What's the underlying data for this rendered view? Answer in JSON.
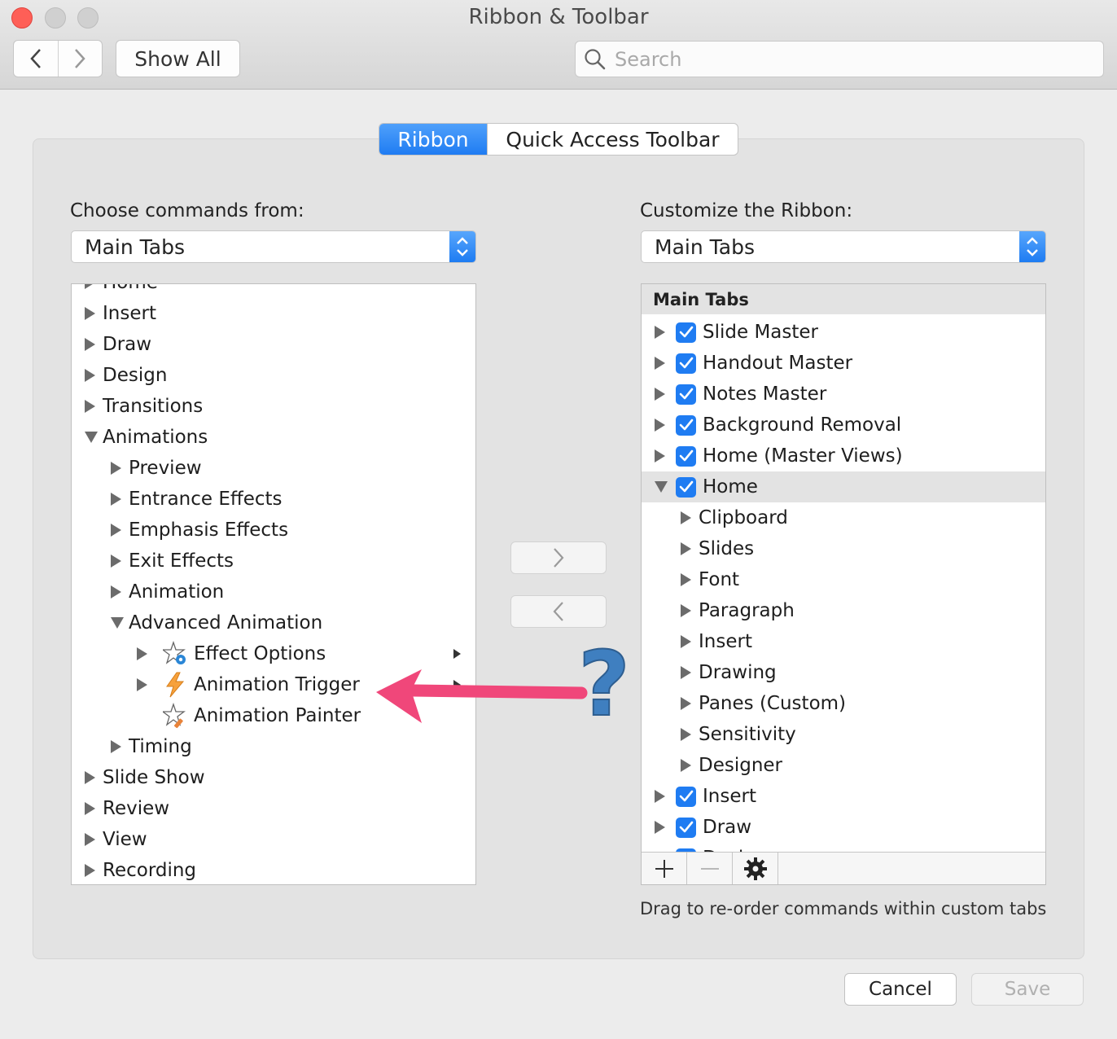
{
  "window": {
    "title": "Ribbon & Toolbar"
  },
  "toolbar": {
    "back_icon": "chevron-left-icon",
    "forward_icon": "chevron-right-icon",
    "show_all_label": "Show All",
    "search_placeholder": "Search",
    "search_value": ""
  },
  "tabs": {
    "items": [
      {
        "label": "Ribbon",
        "selected": true
      },
      {
        "label": "Quick Access Toolbar",
        "selected": false
      }
    ]
  },
  "left": {
    "label": "Choose commands from:",
    "popup_value": "Main Tabs",
    "rows": [
      {
        "label": "Home",
        "kind": "collapsed",
        "level": 0
      },
      {
        "label": "Insert",
        "kind": "collapsed",
        "level": 0
      },
      {
        "label": "Draw",
        "kind": "collapsed",
        "level": 0
      },
      {
        "label": "Design",
        "kind": "collapsed",
        "level": 0
      },
      {
        "label": "Transitions",
        "kind": "collapsed",
        "level": 0
      },
      {
        "label": "Animations",
        "kind": "expanded",
        "level": 0
      },
      {
        "label": "Preview",
        "kind": "collapsed",
        "level": 1
      },
      {
        "label": "Entrance Effects",
        "kind": "collapsed",
        "level": 1
      },
      {
        "label": "Emphasis Effects",
        "kind": "collapsed",
        "level": 1
      },
      {
        "label": "Exit Effects",
        "kind": "collapsed",
        "level": 1
      },
      {
        "label": "Animation",
        "kind": "collapsed",
        "level": 1
      },
      {
        "label": "Advanced Animation",
        "kind": "expanded",
        "level": 1
      },
      {
        "label": "Effect Options",
        "kind": "collapsed",
        "level": 2,
        "icon": "star-gear-icon",
        "submenu": true
      },
      {
        "label": "Animation Trigger",
        "kind": "collapsed",
        "level": 2,
        "icon": "lightning-icon",
        "submenu": true
      },
      {
        "label": "Animation Painter",
        "kind": "leaf",
        "level": 2,
        "icon": "star-brush-icon",
        "submenu": false
      },
      {
        "label": "Timing",
        "kind": "collapsed",
        "level": 1
      },
      {
        "label": "Slide Show",
        "kind": "collapsed",
        "level": 0
      },
      {
        "label": "Review",
        "kind": "collapsed",
        "level": 0
      },
      {
        "label": "View",
        "kind": "collapsed",
        "level": 0
      },
      {
        "label": "Recording",
        "kind": "collapsed",
        "level": 0
      }
    ]
  },
  "middle": {
    "add_icon": "chevron-right-icon",
    "remove_icon": "chevron-left-icon"
  },
  "right": {
    "label": "Customize the Ribbon:",
    "popup_value": "Main Tabs",
    "header": "Main Tabs",
    "rows": [
      {
        "label": "Slide Master",
        "kind": "collapsed",
        "level": 0,
        "checked": true
      },
      {
        "label": "Handout Master",
        "kind": "collapsed",
        "level": 0,
        "checked": true
      },
      {
        "label": "Notes Master",
        "kind": "collapsed",
        "level": 0,
        "checked": true
      },
      {
        "label": "Background Removal",
        "kind": "collapsed",
        "level": 0,
        "checked": true
      },
      {
        "label": "Home (Master Views)",
        "kind": "collapsed",
        "level": 0,
        "checked": true
      },
      {
        "label": "Home",
        "kind": "expanded",
        "level": 0,
        "checked": true,
        "selected": true
      },
      {
        "label": "Clipboard",
        "kind": "collapsed",
        "level": 1
      },
      {
        "label": "Slides",
        "kind": "collapsed",
        "level": 1
      },
      {
        "label": "Font",
        "kind": "collapsed",
        "level": 1
      },
      {
        "label": "Paragraph",
        "kind": "collapsed",
        "level": 1
      },
      {
        "label": "Insert",
        "kind": "collapsed",
        "level": 1
      },
      {
        "label": "Drawing",
        "kind": "collapsed",
        "level": 1
      },
      {
        "label": "Panes (Custom)",
        "kind": "collapsed",
        "level": 1
      },
      {
        "label": "Sensitivity",
        "kind": "collapsed",
        "level": 1
      },
      {
        "label": "Designer",
        "kind": "collapsed",
        "level": 1
      },
      {
        "label": "Insert",
        "kind": "collapsed",
        "level": 0,
        "checked": true
      },
      {
        "label": "Draw",
        "kind": "collapsed",
        "level": 0,
        "checked": true
      },
      {
        "label": "Design",
        "kind": "collapsed",
        "level": 0,
        "checked": true
      }
    ],
    "bottom_buttons": [
      "plus-icon",
      "minus-icon",
      "gear-icon"
    ],
    "hint": "Drag to re-order commands within custom tabs"
  },
  "footer": {
    "cancel_label": "Cancel",
    "save_label": "Save"
  },
  "annotation": {
    "arrow_color": "#f0477a",
    "question_color": "#3f7fc0",
    "question_mark": "?"
  },
  "colors": {
    "accent": "#1f7cf2",
    "close": "#fe5f57"
  }
}
